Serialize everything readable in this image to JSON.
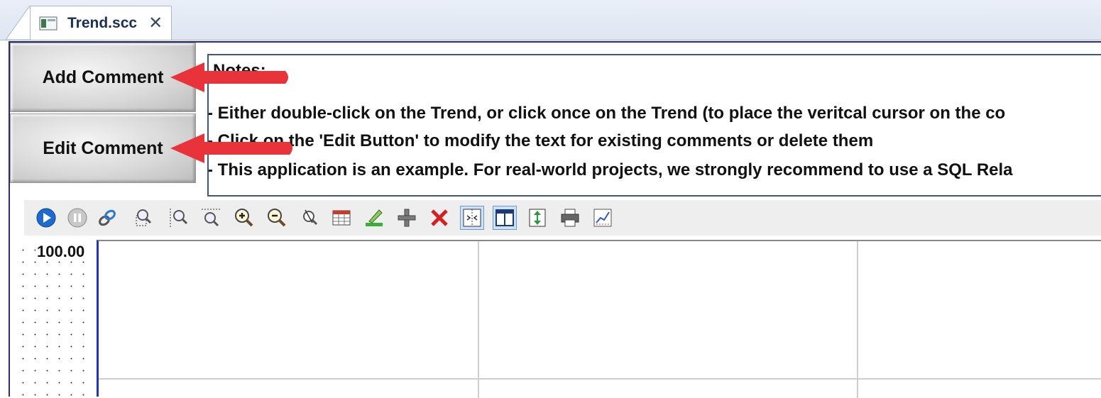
{
  "tab": {
    "title": "Trend.scc",
    "close_glyph": "✕",
    "icon": "document-icon"
  },
  "buttons": {
    "add_comment": "Add Comment",
    "edit_comment": "Edit Comment"
  },
  "notes": {
    "title": "Notes:",
    "lines": [
      "- Either double-click on the Trend, or click once on the Trend (to place the veritcal cursor on the co",
      "- Click on the 'Edit Button' to modify the text for existing comments or delete them",
      "- This application is an example. For real-world projects, we strongly recommend to use a SQL Rela"
    ]
  },
  "toolbar": {
    "tools": [
      "play-icon",
      "pause-icon",
      "link-icon",
      "zoom-area-icon",
      "zoom-cursor-icon",
      "zoom-fit-icon",
      "zoom-in-icon",
      "zoom-out-icon",
      "zoom-reset-icon",
      "table-icon",
      "highlight-icon",
      "add-pen-icon",
      "delete-icon",
      "cursor-mode-icon",
      "window-icon",
      "vertical-scale-icon",
      "print-icon",
      "chart-settings-icon"
    ]
  },
  "trend": {
    "y_max_label": "100.00"
  },
  "colors": {
    "arrow": "#e8333b",
    "plot_border": "#2234b8",
    "tab_text": "#1a2f5a"
  }
}
